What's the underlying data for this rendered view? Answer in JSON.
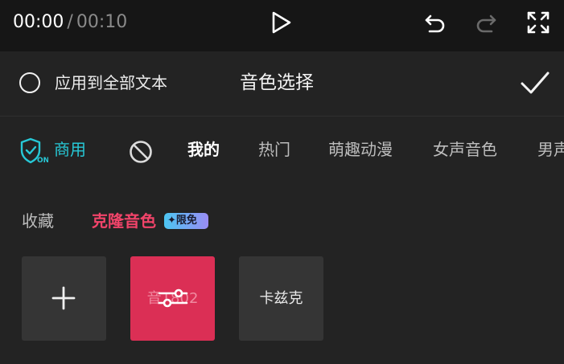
{
  "player": {
    "current_time": "00:00",
    "separator": "/",
    "duration": "00:10"
  },
  "header": {
    "apply_all_label": "应用到全部文本",
    "title": "音色选择"
  },
  "tabs": {
    "commercial": "商用",
    "shield_badge_text": "ON",
    "items": [
      "我的",
      "热门",
      "萌趣动漫",
      "女声音色",
      "男声"
    ]
  },
  "subtabs": {
    "favorites": "收藏",
    "clone": "克隆音色",
    "badge": "✦限免"
  },
  "cards": {
    "add_symbol": "+",
    "selected_label": "音1802",
    "kazike": "卡兹克"
  },
  "colors": {
    "accent_teal": "#27c8d6",
    "accent_pink": "#f2446a",
    "selected_card": "#db2f55"
  }
}
